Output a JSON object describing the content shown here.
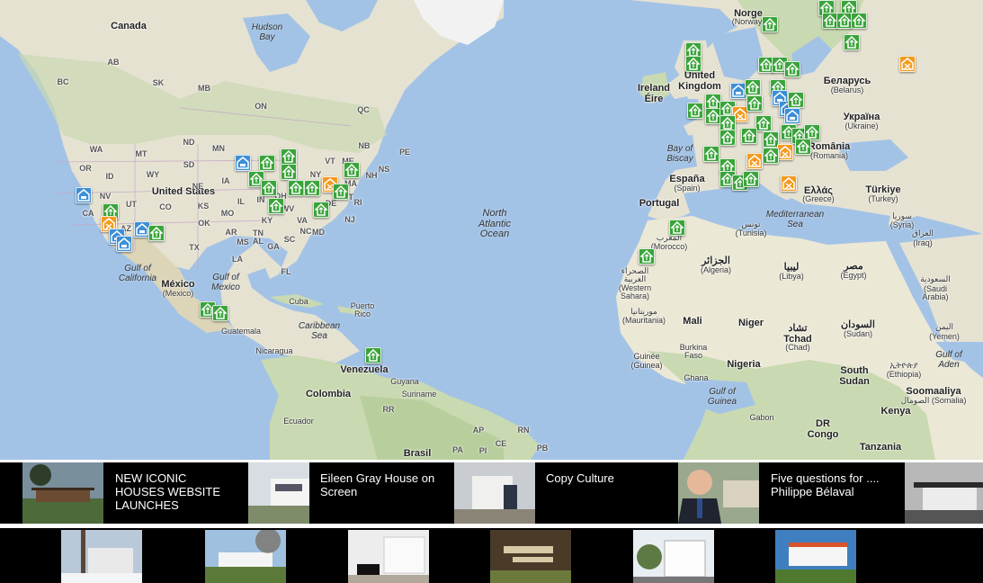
{
  "map": {
    "labels": {
      "canada": "Canada",
      "hudson_bay": "Hudson Bay",
      "united_states": "United States",
      "mexico": "México",
      "mexico_sub": "(Mexico)",
      "gulf_mexico": "Gulf of Mexico",
      "gulf_california": "Gulf of California",
      "cuba": "Cuba",
      "puerto_rico": "Puerto Rico",
      "caribbean": "Caribbean Sea",
      "guatemala": "Guatemala",
      "nicaragua": "Nicaragua",
      "venezuela": "Venezuela",
      "colombia": "Colombia",
      "ecuador": "Ecuador",
      "guyana": "Guyana",
      "suriname": "Suriname",
      "brasil": "Brasil",
      "north_atlantic": "North Atlantic Ocean",
      "norge": "Norge",
      "norge_sub": "(Norway)",
      "united_kingdom": "United Kingdom",
      "ireland": "Ireland Éire",
      "bay_biscay": "Bay of Biscay",
      "espana": "España",
      "espana_sub": "(Spain)",
      "portugal": "Portugal",
      "belarus": "Беларусь",
      "belarus_sub": "(Belarus)",
      "ukraine": "Україна",
      "ukraine_sub": "(Ukraine)",
      "romania": "România",
      "romania_sub": "(Romania)",
      "greece": "Ελλάς",
      "greece_sub": "(Greece)",
      "turkey": "Türkiye",
      "turkey_sub": "(Turkey)",
      "mediterranean": "Mediterranean Sea",
      "morocco": "المغرب",
      "morocco_sub": "(Morocco)",
      "tunisia": "تونس",
      "tunisia_sub": "(Tunisia)",
      "algeria": "الجزائر",
      "algeria_sub": "(Algeria)",
      "libya": "ليبيا",
      "libya_sub": "(Libya)",
      "egypt": "مصر",
      "egypt_sub": "(Egypt)",
      "syria": "سوريا",
      "syria_sub": "(Syria)",
      "iraq": "العراق",
      "iraq_sub": "(Iraq)",
      "saudi": "السعودية",
      "saudi_sub": "(Saudi Arabia)",
      "yemen": "اليمن",
      "yemen_sub": "(Yemen)",
      "western_sahara": "الصحراء الغربية",
      "western_sahara_sub": "(Western Sahara)",
      "mauritania": "موريتانيا",
      "mauritania_sub": "(Mauritania)",
      "mali": "Mali",
      "niger": "Niger",
      "chad": "تشاد Tchad",
      "chad_sub": "(Chad)",
      "sudan": "السودان",
      "sudan_sub": "(Sudan)",
      "burkina": "Burkina Faso",
      "guinee": "Guinée",
      "guinee_sub": "(Guinea)",
      "ghana": "Ghana",
      "nigeria": "Nigeria",
      "gulf_guinea": "Gulf of Guinea",
      "gabon": "Gabon",
      "dr_congo": "DR Congo",
      "south_sudan": "South Sudan",
      "ethiopia": "ኢትዮጵያ",
      "ethiopia_sub": "(Ethiopia)",
      "somalia": "Soomaaliya",
      "somalia_sub": "الصومال (Somalia)",
      "kenya": "Kenya",
      "tanzania": "Tanzania",
      "gulf_aden": "Gulf of Aden"
    },
    "states": [
      "BC",
      "AB",
      "SK",
      "MB",
      "ON",
      "QC",
      "NB",
      "PE",
      "NS",
      "WA",
      "MT",
      "ND",
      "MN",
      "OR",
      "ID",
      "WY",
      "SD",
      "NV",
      "UT",
      "CO",
      "NE",
      "KS",
      "IA",
      "IL",
      "IN",
      "OH",
      "WI",
      "MI",
      "NY",
      "VT",
      "ME",
      "NH",
      "MA",
      "RI",
      "CT",
      "NJ",
      "PA",
      "WV",
      "VA",
      "MD",
      "DE",
      "KY",
      "TN",
      "NC",
      "SC",
      "GA",
      "FL",
      "AL",
      "MS",
      "LA",
      "AR",
      "OK",
      "TX",
      "NM",
      "AZ",
      "CA",
      "MO",
      "RR",
      "AP",
      "PA",
      "RN",
      "PB",
      "PI",
      "CE"
    ],
    "marker_colors": {
      "green": "#3aa43a",
      "blue": "#3d8fd6",
      "orange": "#f39a1f"
    }
  },
  "news": [
    {
      "title": "NEW ICONIC HOUSES WEBSITE LAUNCHES"
    },
    {
      "title": "Eileen Gray House on Screen"
    },
    {
      "title": "Copy Culture"
    },
    {
      "title": "Five questions for .... Philippe Bélaval"
    }
  ]
}
